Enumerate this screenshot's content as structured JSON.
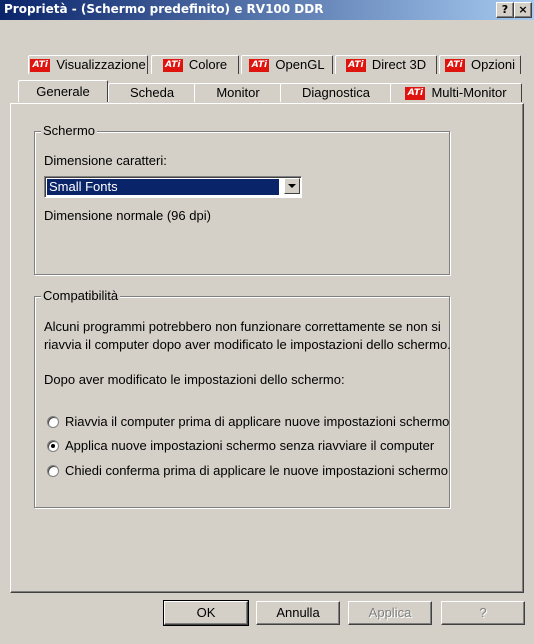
{
  "window": {
    "title": "Proprietà - (Schermo predefinito) e RV100 DDR",
    "help_btn": "?",
    "close_btn": "×"
  },
  "tabs_row1": [
    {
      "label": "Visualizzazione",
      "icon": "ati-logo-icon"
    },
    {
      "label": "Colore",
      "icon": "ati-logo-icon"
    },
    {
      "label": "OpenGL",
      "icon": "ati-logo-icon"
    },
    {
      "label": "Direct 3D",
      "icon": "ati-logo-icon"
    },
    {
      "label": "Opzioni",
      "icon": "ati-logo-icon"
    }
  ],
  "tabs_row2": [
    {
      "label": "Generale",
      "active": true
    },
    {
      "label": "Scheda"
    },
    {
      "label": "Monitor"
    },
    {
      "label": "Diagnostica"
    },
    {
      "label": "Multi-Monitor",
      "icon": "ati-logo-icon"
    }
  ],
  "ati_icon_text": "ATi",
  "schermo": {
    "legend": "Schermo",
    "font_size_label": "Dimensione caratteri:",
    "font_size_value": "Small Fonts",
    "dpi_text": "Dimensione normale (96 dpi)"
  },
  "compat": {
    "legend": "Compatibilità",
    "desc_line1": "Alcuni programmi potrebbero non funzionare correttamente se non si",
    "desc_line2": "riavvia il computer dopo aver modificato le impostazioni dello schermo.",
    "after_label": "Dopo aver modificato le impostazioni dello schermo:",
    "options": [
      {
        "label": "Riavvia il computer prima di applicare nuove impostazioni schermo",
        "selected": false
      },
      {
        "label": "Applica nuove impostazioni schermo senza riavviare il computer",
        "selected": true
      },
      {
        "label": "Chiedi conferma prima di applicare le nuove impostazioni schermo",
        "selected": false
      }
    ]
  },
  "buttons": {
    "ok": "OK",
    "cancel": "Annulla",
    "apply": "Applica",
    "help": "?"
  },
  "colors": {
    "titlebar": "#0a246a",
    "face": "#d4d0c8",
    "selection": "#0a246a",
    "ati_red": "#e0140f"
  }
}
